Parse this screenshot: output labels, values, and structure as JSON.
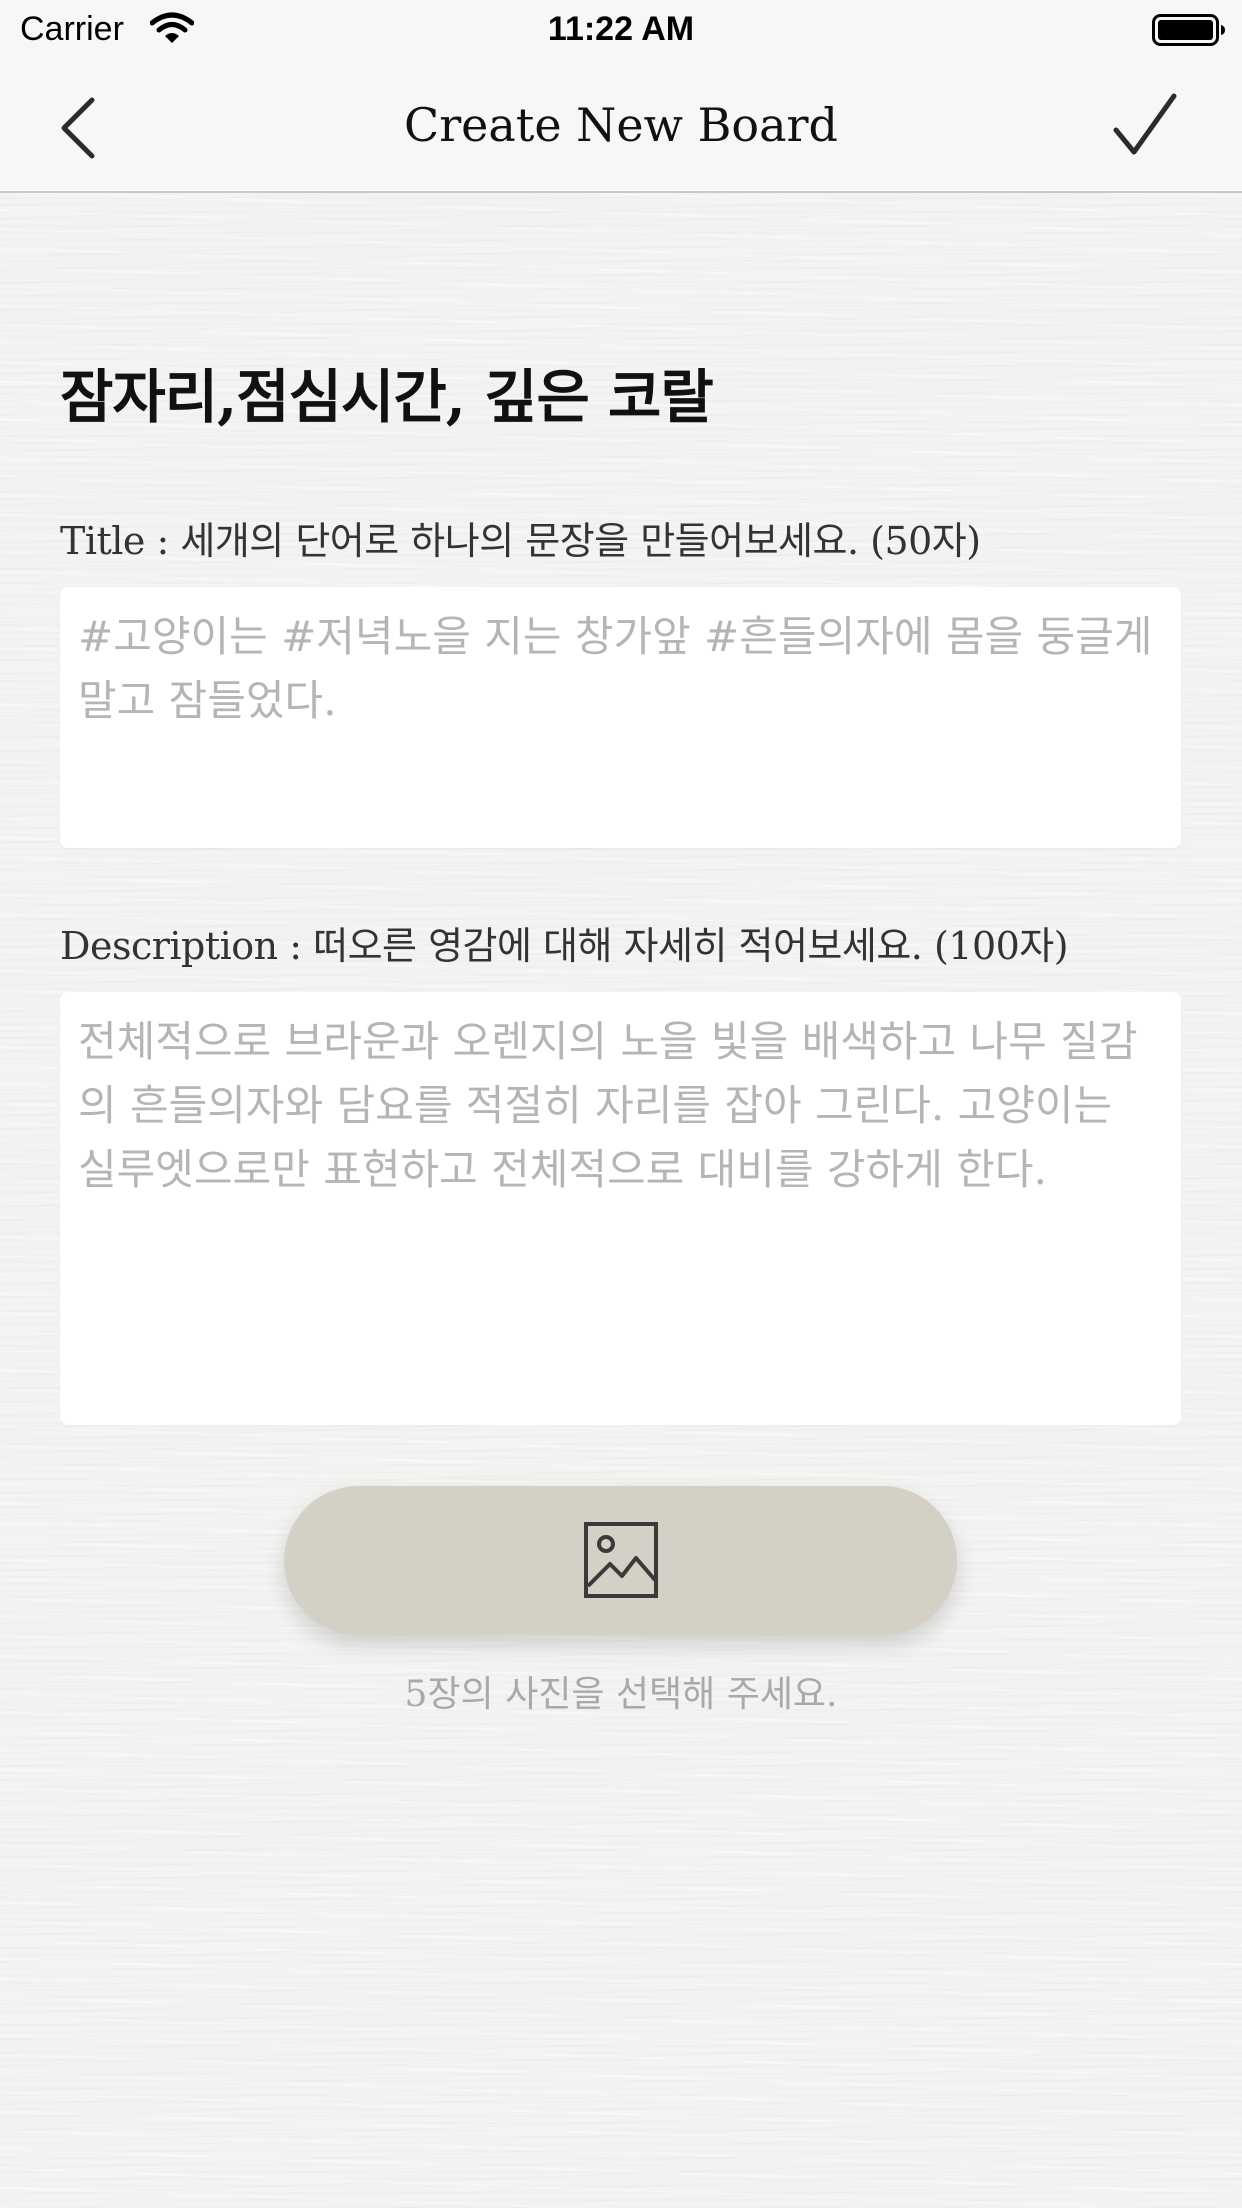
{
  "status_bar": {
    "carrier": "Carrier",
    "time": "11:22 AM",
    "wifi_icon": "wifi-icon",
    "battery_icon": "battery-full-icon"
  },
  "nav": {
    "title": "Create New Board",
    "back_icon": "chevron-left-icon",
    "done_icon": "checkmark-icon"
  },
  "heading": "잠자리,점심시간, 깊은 코랄",
  "title_field": {
    "label": "Title : 세개의 단어로 하나의 문장을 만들어보세요. (50자)",
    "placeholder": "#고양이는 #저녁노을 지는 창가앞 #흔들의자에 몸을 둥글게 말고 잠들었다."
  },
  "description_field": {
    "label": "Description : 떠오른 영감에 대해 자세히 적어보세요. (100자)",
    "placeholder": "전체적으로 브라운과 오렌지의 노을 빛을 배색하고 나무 질감의 흔들의자와 담요를 적절히 자리를 잡아 그린다. 고양이는 실루엣으로만 표현하고 전체적으로 대비를 강하게 한다."
  },
  "photo": {
    "icon": "image-icon",
    "hint": "5장의 사진을 선택해 주세요."
  },
  "colors": {
    "photo_button": "#d4d0c5",
    "placeholder_text": "#b5b5b5",
    "background": "#f3f3f2"
  }
}
